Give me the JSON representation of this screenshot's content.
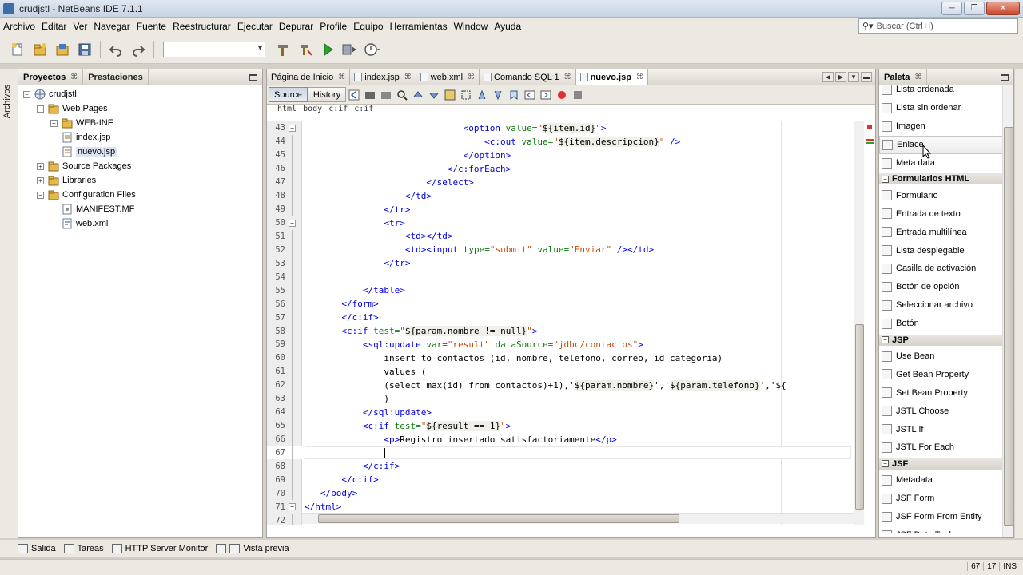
{
  "window": {
    "title": "crudjstl - NetBeans IDE 7.1.1",
    "buttons": [
      "─",
      "❐",
      "✕"
    ]
  },
  "menu": [
    "Archivo",
    "Editar",
    "Ver",
    "Navegar",
    "Fuente",
    "Reestructurar",
    "Ejecutar",
    "Depurar",
    "Profile",
    "Equipo",
    "Herramientas",
    "Window",
    "Ayuda"
  ],
  "search": {
    "placeholder": "Buscar (Ctrl+I)"
  },
  "left_strip": {
    "label": "Archivos"
  },
  "left_panel": {
    "tabs": [
      {
        "label": "Proyectos",
        "close": "⌘"
      },
      {
        "label": "Prestaciones"
      }
    ],
    "tree": [
      {
        "label": "crudjstl",
        "level": 0,
        "toggle": "−",
        "icon": "globe-icon"
      },
      {
        "label": "Web Pages",
        "level": 1,
        "toggle": "−",
        "icon": "folder-icon"
      },
      {
        "label": "WEB-INF",
        "level": 2,
        "toggle": "+",
        "icon": "folder-icon"
      },
      {
        "label": "index.jsp",
        "level": 2,
        "toggle": "",
        "icon": "jsp-file-icon"
      },
      {
        "label": "nuevo.jsp",
        "level": 2,
        "toggle": "",
        "icon": "jsp-file-icon",
        "selected": true
      },
      {
        "label": "Source Packages",
        "level": 1,
        "toggle": "+",
        "icon": "folder-icon"
      },
      {
        "label": "Libraries",
        "level": 1,
        "toggle": "+",
        "icon": "folder-icon"
      },
      {
        "label": "Configuration Files",
        "level": 1,
        "toggle": "−",
        "icon": "folder-icon"
      },
      {
        "label": "MANIFEST.MF",
        "level": 2,
        "toggle": "",
        "icon": "file-icon"
      },
      {
        "label": "web.xml",
        "level": 2,
        "toggle": "",
        "icon": "xml-file-icon"
      }
    ]
  },
  "editor": {
    "tabs": [
      {
        "label": "Página de Inicio",
        "active": false
      },
      {
        "label": "index.jsp",
        "active": false
      },
      {
        "label": "web.xml",
        "active": false
      },
      {
        "label": "Comando SQL 1",
        "active": false
      },
      {
        "label": "nuevo.jsp",
        "active": true
      }
    ],
    "tab_close": "⌘",
    "toolbar": {
      "source_label": "Source",
      "history_label": "History"
    },
    "breadcrumb": [
      "html",
      "body",
      "c:if",
      "c:if"
    ],
    "lines": [
      {
        "n": "43",
        "fold": "−",
        "parts": [
          [
            "",
            "                              "
          ],
          [
            "tag",
            "<option "
          ],
          [
            "attr",
            "value="
          ],
          [
            "str",
            "\""
          ],
          [
            "el",
            "${item.id}"
          ],
          [
            "str",
            "\""
          ],
          [
            "tag",
            ">"
          ]
        ]
      },
      {
        "n": "44",
        "fold": "",
        "parts": [
          [
            "",
            "                                  "
          ],
          [
            "tag",
            "<c:out "
          ],
          [
            "attr",
            "value="
          ],
          [
            "str",
            "\""
          ],
          [
            "el",
            "${item.descripcion}"
          ],
          [
            "str",
            "\""
          ],
          [
            "tag",
            " />"
          ]
        ]
      },
      {
        "n": "45",
        "fold": "",
        "parts": [
          [
            "",
            "                              "
          ],
          [
            "tag",
            "</option>"
          ]
        ]
      },
      {
        "n": "46",
        "fold": "",
        "parts": [
          [
            "",
            "                           "
          ],
          [
            "tag",
            "</c:forEach>"
          ]
        ]
      },
      {
        "n": "47",
        "fold": "",
        "parts": [
          [
            "",
            "                       "
          ],
          [
            "tag",
            "</select>"
          ]
        ]
      },
      {
        "n": "48",
        "fold": "",
        "parts": [
          [
            "",
            "                   "
          ],
          [
            "tag",
            "</td>"
          ]
        ]
      },
      {
        "n": "49",
        "fold": "",
        "parts": [
          [
            "",
            "               "
          ],
          [
            "tag",
            "</tr>"
          ]
        ]
      },
      {
        "n": "50",
        "fold": "−",
        "parts": [
          [
            "",
            "               "
          ],
          [
            "tag",
            "<tr>"
          ]
        ]
      },
      {
        "n": "51",
        "fold": "",
        "parts": [
          [
            "",
            "                   "
          ],
          [
            "tag",
            "<td></td>"
          ]
        ]
      },
      {
        "n": "52",
        "fold": "",
        "parts": [
          [
            "",
            "                   "
          ],
          [
            "tag",
            "<td><input "
          ],
          [
            "attr",
            "type="
          ],
          [
            "str",
            "\"submit\""
          ],
          [
            "attr",
            " value="
          ],
          [
            "str",
            "\"Enviar\""
          ],
          [
            "tag",
            " /></td>"
          ]
        ]
      },
      {
        "n": "53",
        "fold": "",
        "parts": [
          [
            "",
            "               "
          ],
          [
            "tag",
            "</tr>"
          ]
        ]
      },
      {
        "n": "54",
        "fold": "",
        "parts": [
          [
            "",
            ""
          ]
        ]
      },
      {
        "n": "55",
        "fold": "",
        "parts": [
          [
            "",
            "           "
          ],
          [
            "tag",
            "</table>"
          ]
        ]
      },
      {
        "n": "56",
        "fold": "",
        "parts": [
          [
            "",
            "       "
          ],
          [
            "tag",
            "</form>"
          ]
        ]
      },
      {
        "n": "57",
        "fold": "",
        "parts": [
          [
            "",
            "       "
          ],
          [
            "tag",
            "</c:if>"
          ]
        ]
      },
      {
        "n": "58",
        "fold": "",
        "parts": [
          [
            "",
            "       "
          ],
          [
            "tag",
            "<c:if "
          ],
          [
            "attr",
            "test="
          ],
          [
            "str",
            "\""
          ],
          [
            "el",
            "${param.nombre != null}"
          ],
          [
            "str",
            "\""
          ],
          [
            "tag",
            ">"
          ]
        ]
      },
      {
        "n": "59",
        "fold": "",
        "parts": [
          [
            "",
            "           "
          ],
          [
            "tag",
            "<sql:update "
          ],
          [
            "attr",
            "var="
          ],
          [
            "str",
            "\"result\""
          ],
          [
            "attr",
            " dataSource="
          ],
          [
            "str",
            "\"jdbc/contactos\""
          ],
          [
            "tag",
            ">"
          ]
        ]
      },
      {
        "n": "60",
        "fold": "",
        "parts": [
          [
            "txt",
            "               insert to contactos (id, nombre, telefono, correo, id_categoria)"
          ]
        ]
      },
      {
        "n": "61",
        "fold": "",
        "parts": [
          [
            "txt",
            "               values ("
          ]
        ]
      },
      {
        "n": "62",
        "fold": "",
        "parts": [
          [
            "txt",
            "               (select max(id) from contactos)+1),'"
          ],
          [
            "el",
            "${param.nombre}"
          ],
          [
            "txt",
            "','"
          ],
          [
            "el",
            "${param.telefono}"
          ],
          [
            "txt",
            "','${"
          ]
        ]
      },
      {
        "n": "63",
        "fold": "",
        "parts": [
          [
            "txt",
            "               )"
          ]
        ]
      },
      {
        "n": "64",
        "fold": "",
        "parts": [
          [
            "",
            "           "
          ],
          [
            "tag",
            "</sql:update>"
          ]
        ]
      },
      {
        "n": "65",
        "fold": "",
        "parts": [
          [
            "",
            "           "
          ],
          [
            "tag",
            "<c:if "
          ],
          [
            "attr",
            "test="
          ],
          [
            "str",
            "\""
          ],
          [
            "el",
            "${result == 1}"
          ],
          [
            "str",
            "\""
          ],
          [
            "tag",
            ">"
          ]
        ]
      },
      {
        "n": "66",
        "fold": "",
        "parts": [
          [
            "",
            "               "
          ],
          [
            "tag",
            "<p>"
          ],
          [
            "txt",
            "Registro insertado satisfactoriamente"
          ],
          [
            "tag",
            "</p>"
          ]
        ]
      },
      {
        "n": "67",
        "fold": "",
        "current": true,
        "parts": [
          [
            "",
            "               "
          ]
        ]
      },
      {
        "n": "68",
        "fold": "",
        "parts": [
          [
            "",
            "           "
          ],
          [
            "tag",
            "</c:if>"
          ]
        ]
      },
      {
        "n": "69",
        "fold": "",
        "parts": [
          [
            "",
            "       "
          ],
          [
            "tag",
            "</c:if>"
          ]
        ]
      },
      {
        "n": "70",
        "fold": "",
        "parts": [
          [
            "",
            "   "
          ],
          [
            "tag",
            "</body>"
          ]
        ]
      },
      {
        "n": "71",
        "fold": "−",
        "parts": [
          [
            "tag",
            "</html>"
          ]
        ]
      },
      {
        "n": "72",
        "fold": "",
        "parts": [
          [
            "",
            ""
          ]
        ]
      }
    ]
  },
  "palette": {
    "title": "Paleta",
    "items": [
      {
        "type": "item",
        "label": "Lista ordenada"
      },
      {
        "type": "item",
        "label": "Lista sin ordenar"
      },
      {
        "type": "item",
        "label": "Imagen"
      },
      {
        "type": "item",
        "label": "Enlace",
        "hover": true
      },
      {
        "type": "item",
        "label": "Meta data"
      },
      {
        "type": "cat",
        "label": "Formularios HTML"
      },
      {
        "type": "item",
        "label": "Formulario"
      },
      {
        "type": "item",
        "label": "Entrada de texto"
      },
      {
        "type": "item",
        "label": "Entrada multilínea"
      },
      {
        "type": "item",
        "label": "Lista desplegable"
      },
      {
        "type": "item",
        "label": "Casilla de activación"
      },
      {
        "type": "item",
        "label": "Botón de opción"
      },
      {
        "type": "item",
        "label": "Seleccionar archivo"
      },
      {
        "type": "item",
        "label": "Botón"
      },
      {
        "type": "cat",
        "label": "JSP"
      },
      {
        "type": "item",
        "label": "Use Bean"
      },
      {
        "type": "item",
        "label": "Get Bean Property"
      },
      {
        "type": "item",
        "label": "Set Bean Property"
      },
      {
        "type": "item",
        "label": "JSTL Choose"
      },
      {
        "type": "item",
        "label": "JSTL If"
      },
      {
        "type": "item",
        "label": "JSTL For Each"
      },
      {
        "type": "cat",
        "label": "JSF"
      },
      {
        "type": "item",
        "label": "Metadata"
      },
      {
        "type": "item",
        "label": "JSF Form"
      },
      {
        "type": "item",
        "label": "JSF Form From Entity"
      },
      {
        "type": "item",
        "label": "JSF Data Table"
      }
    ]
  },
  "bottom_tabs": [
    "Salida",
    "Tareas",
    "HTTP Server Monitor",
    "Vista previa"
  ],
  "status": {
    "line": "67",
    "col": "17",
    "mode": "INS"
  }
}
